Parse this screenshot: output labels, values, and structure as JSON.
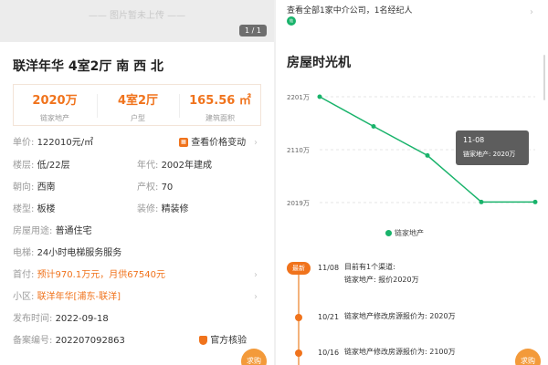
{
  "listing": {
    "photo_placeholder": "—— 图片暂未上传 ——",
    "photo_counter": "1 / 1",
    "title": "联洋年华 4室2厅 南 西 北",
    "stats": [
      {
        "value": "2020万",
        "label": "链家地产"
      },
      {
        "value": "4室2厅",
        "label": "户型"
      },
      {
        "value": "165.56 ㎡",
        "label": "建筑面积"
      }
    ],
    "unit_price_label": "单价:",
    "unit_price": "122010元/㎡",
    "price_change_link": "查看价格变动",
    "floor_label": "楼层:",
    "floor": "低/22层",
    "year_label": "年代:",
    "year": "2002年建成",
    "orientation_label": "朝向:",
    "orientation": "西南",
    "ownership_label": "产权:",
    "ownership": "70",
    "building_label": "楼型:",
    "building": "板楼",
    "decoration_label": "装修:",
    "decoration": "精装修",
    "usage_label": "房屋用途:",
    "usage": "普通住宅",
    "elevator_label": "电梯:",
    "elevator": "24小时电梯服务服务",
    "downpay_label": "首付:",
    "downpay": "预计970.1万元，月供67540元",
    "community_label": "小区:",
    "community": "联洋年华[浦东-联洋]",
    "publish_label": "发布时间:",
    "publish": "2022-09-18",
    "record_label": "备案编号:",
    "record": "202207092863",
    "verify": "官方核验",
    "fab": "求购"
  },
  "agency": {
    "text": "查看全部1家中介公司，1名经纪人",
    "badge": "链"
  },
  "timeline_section": {
    "title": "房屋时光机",
    "legend": "链家地产",
    "tooltip": {
      "date": "11-08",
      "text": "链家地产: 2020万"
    },
    "colors": {
      "line": "#19b36b",
      "accent": "#f0731c"
    },
    "chart_data": {
      "type": "line",
      "y_ticks": [
        "2201万",
        "2110万",
        "2019万"
      ],
      "series": [
        {
          "name": "链家地产",
          "values": [
            2201,
            2150,
            2100,
            2020,
            2020
          ]
        }
      ]
    },
    "events": [
      {
        "tag": "最新",
        "date": "11/08",
        "text": "目前有1个渠道:",
        "text2": "链家地产: 报价2020万"
      },
      {
        "date": "10/21",
        "text": "链家地产修改房源报价为: 2020万"
      },
      {
        "date": "10/16",
        "text": "链家地产修改房源报价为: 2100万"
      }
    ],
    "fab": "求购"
  }
}
